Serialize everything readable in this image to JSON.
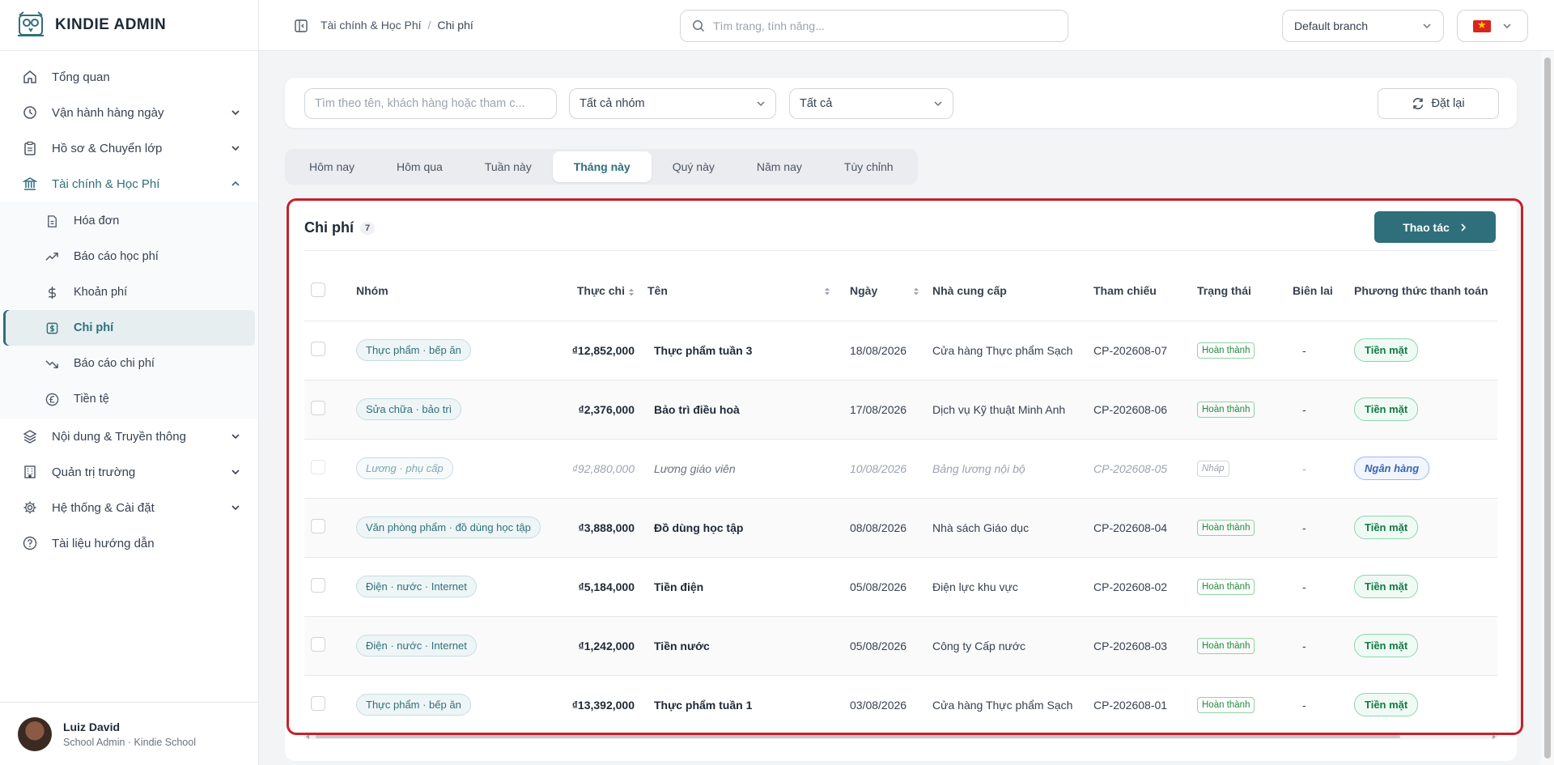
{
  "brand": {
    "name": "KINDIE ADMIN"
  },
  "sidebar": {
    "items": [
      {
        "label": "Tổng quan",
        "icon": "home-icon"
      },
      {
        "label": "Vận hành hàng ngày",
        "icon": "clock-icon"
      },
      {
        "label": "Hồ sơ & Chuyển lớp",
        "icon": "clipboard-icon"
      },
      {
        "label": "Tài chính & Học Phí",
        "icon": "bank-icon"
      }
    ],
    "finance_sub": [
      {
        "label": "Hóa đơn",
        "icon": "invoice-icon"
      },
      {
        "label": "Báo cáo học phí",
        "icon": "trending-up-icon"
      },
      {
        "label": "Khoản phí",
        "icon": "dollar-icon"
      },
      {
        "label": "Chi phí",
        "icon": "expense-icon"
      },
      {
        "label": "Báo cáo chi phí",
        "icon": "trending-down-icon"
      },
      {
        "label": "Tiền tệ",
        "icon": "currency-icon"
      }
    ],
    "items_after": [
      {
        "label": "Nội dung & Truyền thông",
        "icon": "layers-icon"
      },
      {
        "label": "Quản trị trường",
        "icon": "building-icon"
      },
      {
        "label": "Hệ thống & Cài đặt",
        "icon": "gear-icon"
      },
      {
        "label": "Tài liệu hướng dẫn",
        "icon": "help-icon"
      }
    ]
  },
  "user": {
    "name": "Luiz David",
    "role": "School Admin · Kindie School"
  },
  "topbar": {
    "breadcrumb": [
      "Tài chính & Học Phí",
      "/",
      "Chi phí"
    ],
    "search_placeholder": "Tìm trang, tính năng...",
    "branch": "Default branch"
  },
  "filters": {
    "search_placeholder": "Tìm theo tên, khách hàng hoặc tham c...",
    "group": "Tất cả nhóm",
    "status": "Tất cả",
    "reset": "Đặt lại"
  },
  "period_tabs": [
    "Hôm nay",
    "Hôm qua",
    "Tuần này",
    "Tháng này",
    "Quý này",
    "Năm nay",
    "Tùy chỉnh"
  ],
  "period_active": "Tháng này",
  "panel": {
    "title": "Chi phí",
    "count": "7",
    "action": "Thao tác"
  },
  "table": {
    "headers": [
      "Nhóm",
      "Thực chi",
      "Tên",
      "Ngày",
      "Nhà cung cấp",
      "Tham chiếu",
      "Trạng thái",
      "Biên lai",
      "Phương thức thanh toán"
    ],
    "rows": [
      {
        "group": "Thực phẩm · bếp ăn",
        "amount": "₫12,852,000",
        "name": "Thực phẩm tuần 3",
        "date": "18/08/2026",
        "vendor": "Cửa hàng Thực phẩm Sạch",
        "ref": "CP-202608-07",
        "status": "Hoàn thành",
        "receipt": "-",
        "payment": "Tiền mặt"
      },
      {
        "group": "Sửa chữa · bảo trì",
        "amount": "₫2,376,000",
        "name": "Bảo trì điều hoà",
        "date": "17/08/2026",
        "vendor": "Dịch vụ Kỹ thuật Minh Anh",
        "ref": "CP-202608-06",
        "status": "Hoàn thành",
        "receipt": "-",
        "payment": "Tiền mặt"
      },
      {
        "group": "Lương · phụ cấp",
        "amount": "₫92,880,000",
        "name": "Lương giáo viên",
        "date": "10/08/2026",
        "vendor": "Bảng lương nội bộ",
        "ref": "CP-202608-05",
        "status": "Nháp",
        "receipt": "-",
        "payment": "Ngân hàng"
      },
      {
        "group": "Văn phòng phẩm · đồ dùng học tập",
        "amount": "₫3,888,000",
        "name": "Đồ dùng học tập",
        "date": "08/08/2026",
        "vendor": "Nhà sách Giáo dục",
        "ref": "CP-202608-04",
        "status": "Hoàn thành",
        "receipt": "-",
        "payment": "Tiền mặt"
      },
      {
        "group": "Điện · nước · Internet",
        "amount": "₫5,184,000",
        "name": "Tiền điện",
        "date": "05/08/2026",
        "vendor": "Điện lực khu vực",
        "ref": "CP-202608-02",
        "status": "Hoàn thành",
        "receipt": "-",
        "payment": "Tiền mặt"
      },
      {
        "group": "Điện · nước · Internet",
        "amount": "₫1,242,000",
        "name": "Tiền nước",
        "date": "05/08/2026",
        "vendor": "Công ty Cấp nước",
        "ref": "CP-202608-03",
        "status": "Hoàn thành",
        "receipt": "-",
        "payment": "Tiền mặt"
      },
      {
        "group": "Thực phẩm · bếp ăn",
        "amount": "₫13,392,000",
        "name": "Thực phẩm tuần 1",
        "date": "03/08/2026",
        "vendor": "Cửa hàng Thực phẩm Sạch",
        "ref": "CP-202608-01",
        "status": "Hoàn thành",
        "receipt": "-",
        "payment": "Tiền mặt"
      }
    ]
  },
  "colors": {
    "accent": "#2f6f7b",
    "highlight_frame": "#c8202b",
    "success": "#238a3e"
  }
}
